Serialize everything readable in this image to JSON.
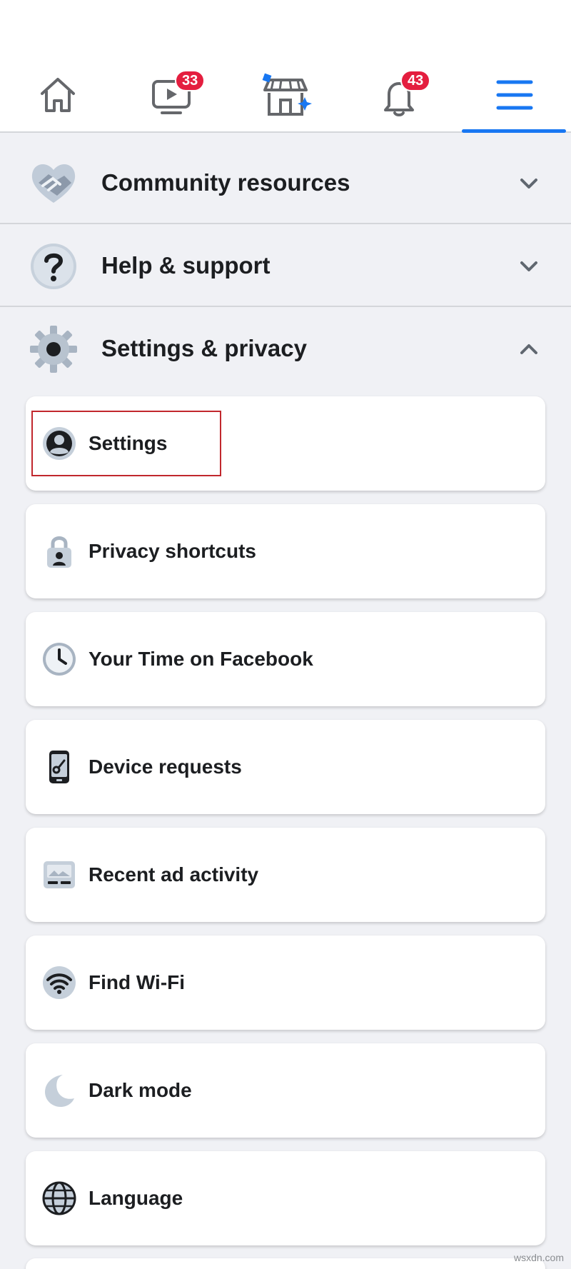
{
  "nav": {
    "items": [
      {
        "name": "home",
        "icon": "home-icon"
      },
      {
        "name": "watch",
        "icon": "video-icon",
        "badge": "33"
      },
      {
        "name": "marketplace",
        "icon": "marketplace-icon"
      },
      {
        "name": "notifications",
        "icon": "bell-icon",
        "badge": "43"
      },
      {
        "name": "menu",
        "icon": "hamburger-menu-icon",
        "active": true
      }
    ],
    "accent_color": "#1877f2",
    "badge_color": "#e41e3f"
  },
  "sections": [
    {
      "label": "Community resources",
      "icon": "handshake-heart-icon",
      "state": "collapsed"
    },
    {
      "label": "Help & support",
      "icon": "question-mark-icon",
      "state": "collapsed"
    },
    {
      "label": "Settings & privacy",
      "icon": "gear-icon",
      "state": "expanded"
    }
  ],
  "settings_items": [
    {
      "label": "Settings",
      "icon": "user-profile-icon",
      "highlighted": true
    },
    {
      "label": "Privacy shortcuts",
      "icon": "lock-user-icon"
    },
    {
      "label": "Your Time on Facebook",
      "icon": "clock-icon"
    },
    {
      "label": "Device requests",
      "icon": "phone-key-icon"
    },
    {
      "label": "Recent ad activity",
      "icon": "ad-image-icon"
    },
    {
      "label": "Find Wi-Fi",
      "icon": "wifi-icon"
    },
    {
      "label": "Dark mode",
      "icon": "moon-icon"
    },
    {
      "label": "Language",
      "icon": "globe-icon"
    }
  ],
  "highlight_color": "#c1272d",
  "watermark": "wsxdn.com"
}
